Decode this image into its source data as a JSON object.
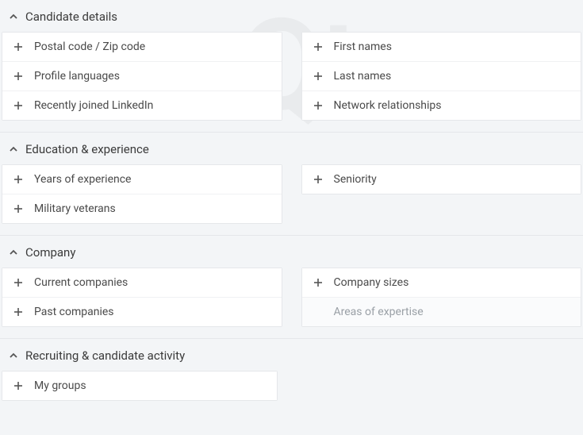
{
  "sections": [
    {
      "title": "Candidate details",
      "left": [
        {
          "label": "Postal code / Zip code"
        },
        {
          "label": "Profile languages"
        },
        {
          "label": "Recently joined LinkedIn"
        }
      ],
      "right": [
        {
          "label": "First names"
        },
        {
          "label": "Last names"
        },
        {
          "label": "Network relationships"
        }
      ]
    },
    {
      "title": "Education & experience",
      "left": [
        {
          "label": "Years of experience"
        },
        {
          "label": "Military veterans"
        }
      ],
      "right": [
        {
          "label": "Seniority"
        }
      ]
    },
    {
      "title": "Company",
      "left": [
        {
          "label": "Current companies"
        },
        {
          "label": "Past companies"
        }
      ],
      "right": [
        {
          "label": "Company sizes"
        },
        {
          "label": "Areas of expertise",
          "muted": true
        }
      ]
    },
    {
      "title": "Recruiting & candidate activity",
      "left": [
        {
          "label": "My groups"
        }
      ],
      "right": []
    }
  ]
}
